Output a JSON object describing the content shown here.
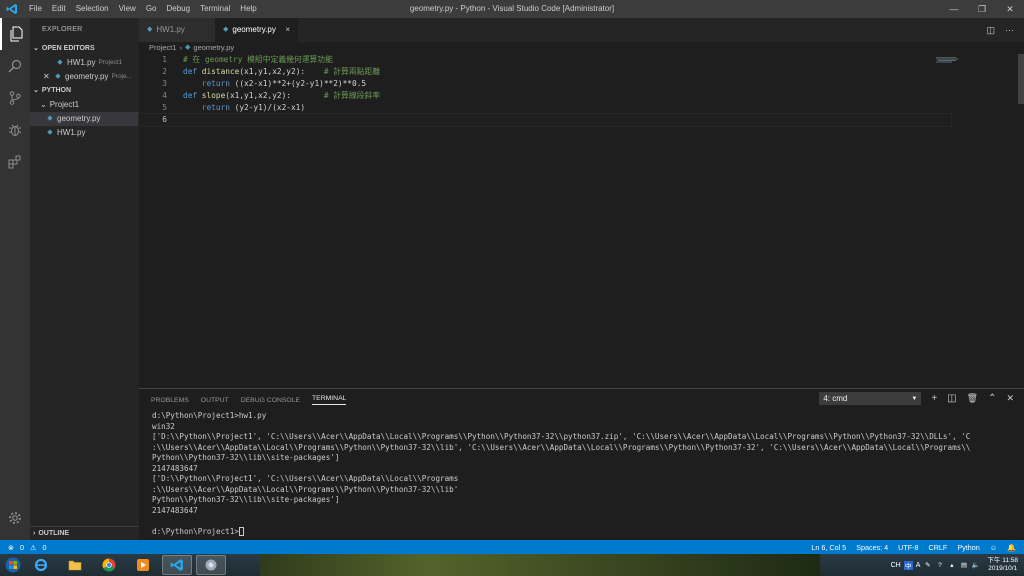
{
  "window": {
    "title": "geometry.py - Python - Visual Studio Code [Administrator]",
    "menu": [
      "File",
      "Edit",
      "Selection",
      "View",
      "Go",
      "Debug",
      "Terminal",
      "Help"
    ]
  },
  "sidebar": {
    "title": "EXPLORER",
    "open_editors_label": "OPEN EDITORS",
    "open_editors": [
      {
        "name": "HW1.py",
        "folder": "Project1"
      },
      {
        "name": "geometry.py",
        "folder": "Proje..."
      }
    ],
    "workspace_label": "PYTHON",
    "folder": "Project1",
    "files": [
      "geometry.py",
      "HW1.py"
    ],
    "outline_label": "OUTLINE"
  },
  "tabs": [
    {
      "label": "HW1.py",
      "active": false
    },
    {
      "label": "geometry.py",
      "active": true,
      "close": "×"
    }
  ],
  "breadcrumb": {
    "folder": "Project1",
    "sep": "›",
    "file": "geometry.py"
  },
  "code": {
    "lines": [
      {
        "n": "1",
        "comment": "# 在 geometry 模組中定義幾何運算功能"
      },
      {
        "n": "2",
        "kw": "def",
        "fn": "distance",
        "rest": "(x1,y1,x2,y2):",
        "pad": "    ",
        "comment": "# 計算兩點距離"
      },
      {
        "n": "3",
        "indent": "    ",
        "kw": "return",
        "rest": " ((x2-x1)**2+(y2-y1)**2)**0.5"
      },
      {
        "n": "4",
        "kw": "def",
        "fn": "slope",
        "rest": "(x1,y1,x2,y2):",
        "pad": "       ",
        "comment": "# 計算線段斜率"
      },
      {
        "n": "5",
        "indent": "    ",
        "kw": "return",
        "rest": " (y2-y1)/(x2-x1)"
      },
      {
        "n": "6"
      }
    ]
  },
  "panel": {
    "tabs": [
      "PROBLEMS",
      "OUTPUT",
      "DEBUG CONSOLE",
      "TERMINAL"
    ],
    "active_tab": "TERMINAL",
    "terminal_select": "4: cmd",
    "terminal": [
      "d:\\Python\\Project1>hw1.py",
      "win32",
      "['D:\\\\Python\\\\Project1', 'C:\\\\Users\\\\Acer\\\\AppData\\\\Local\\\\Programs\\\\Python\\\\Python37-32\\\\python37.zip', 'C:\\\\Users\\\\Acer\\\\AppData\\\\Local\\\\Programs\\\\Python\\\\Python37-32\\\\DLLs', 'C",
      ":\\\\Users\\\\Acer\\\\AppData\\\\Local\\\\Programs\\\\Python\\\\Python37-32\\\\lib', 'C:\\\\Users\\\\Acer\\\\AppData\\\\Local\\\\Programs\\\\Python\\\\Python37-32', 'C:\\\\Users\\\\Acer\\\\AppData\\\\Local\\\\Programs\\\\",
      "Python\\\\Python37-32\\\\lib\\\\site-packages']",
      "2147483647",
      "['D:\\\\Python\\\\Project1', 'C:\\\\Users\\\\Acer\\\\AppData\\\\Local\\\\Programs",
      ":\\\\Users\\\\Acer\\\\AppData\\\\Local\\\\Programs\\\\Python\\\\Python37-32\\\\lib'",
      "Python\\\\Python37-32\\\\lib\\\\site-packages']",
      "2147483647",
      "",
      "d:\\Python\\Project1>"
    ]
  },
  "statusbar": {
    "errors": "0",
    "warnings": "0",
    "position": "Ln 6, Col 5",
    "spaces": "Spaces: 4",
    "encoding": "UTF-8",
    "eol": "CRLF",
    "language": "Python"
  },
  "taskbar": {
    "tray_lang": "CH",
    "tray_a": "A",
    "time": "下午 11:58",
    "date": "2019/10/1"
  },
  "colors": {
    "accent": "#007acc",
    "keyword": "#569cd6",
    "function": "#dcdcaa",
    "comment": "#6a9955"
  }
}
